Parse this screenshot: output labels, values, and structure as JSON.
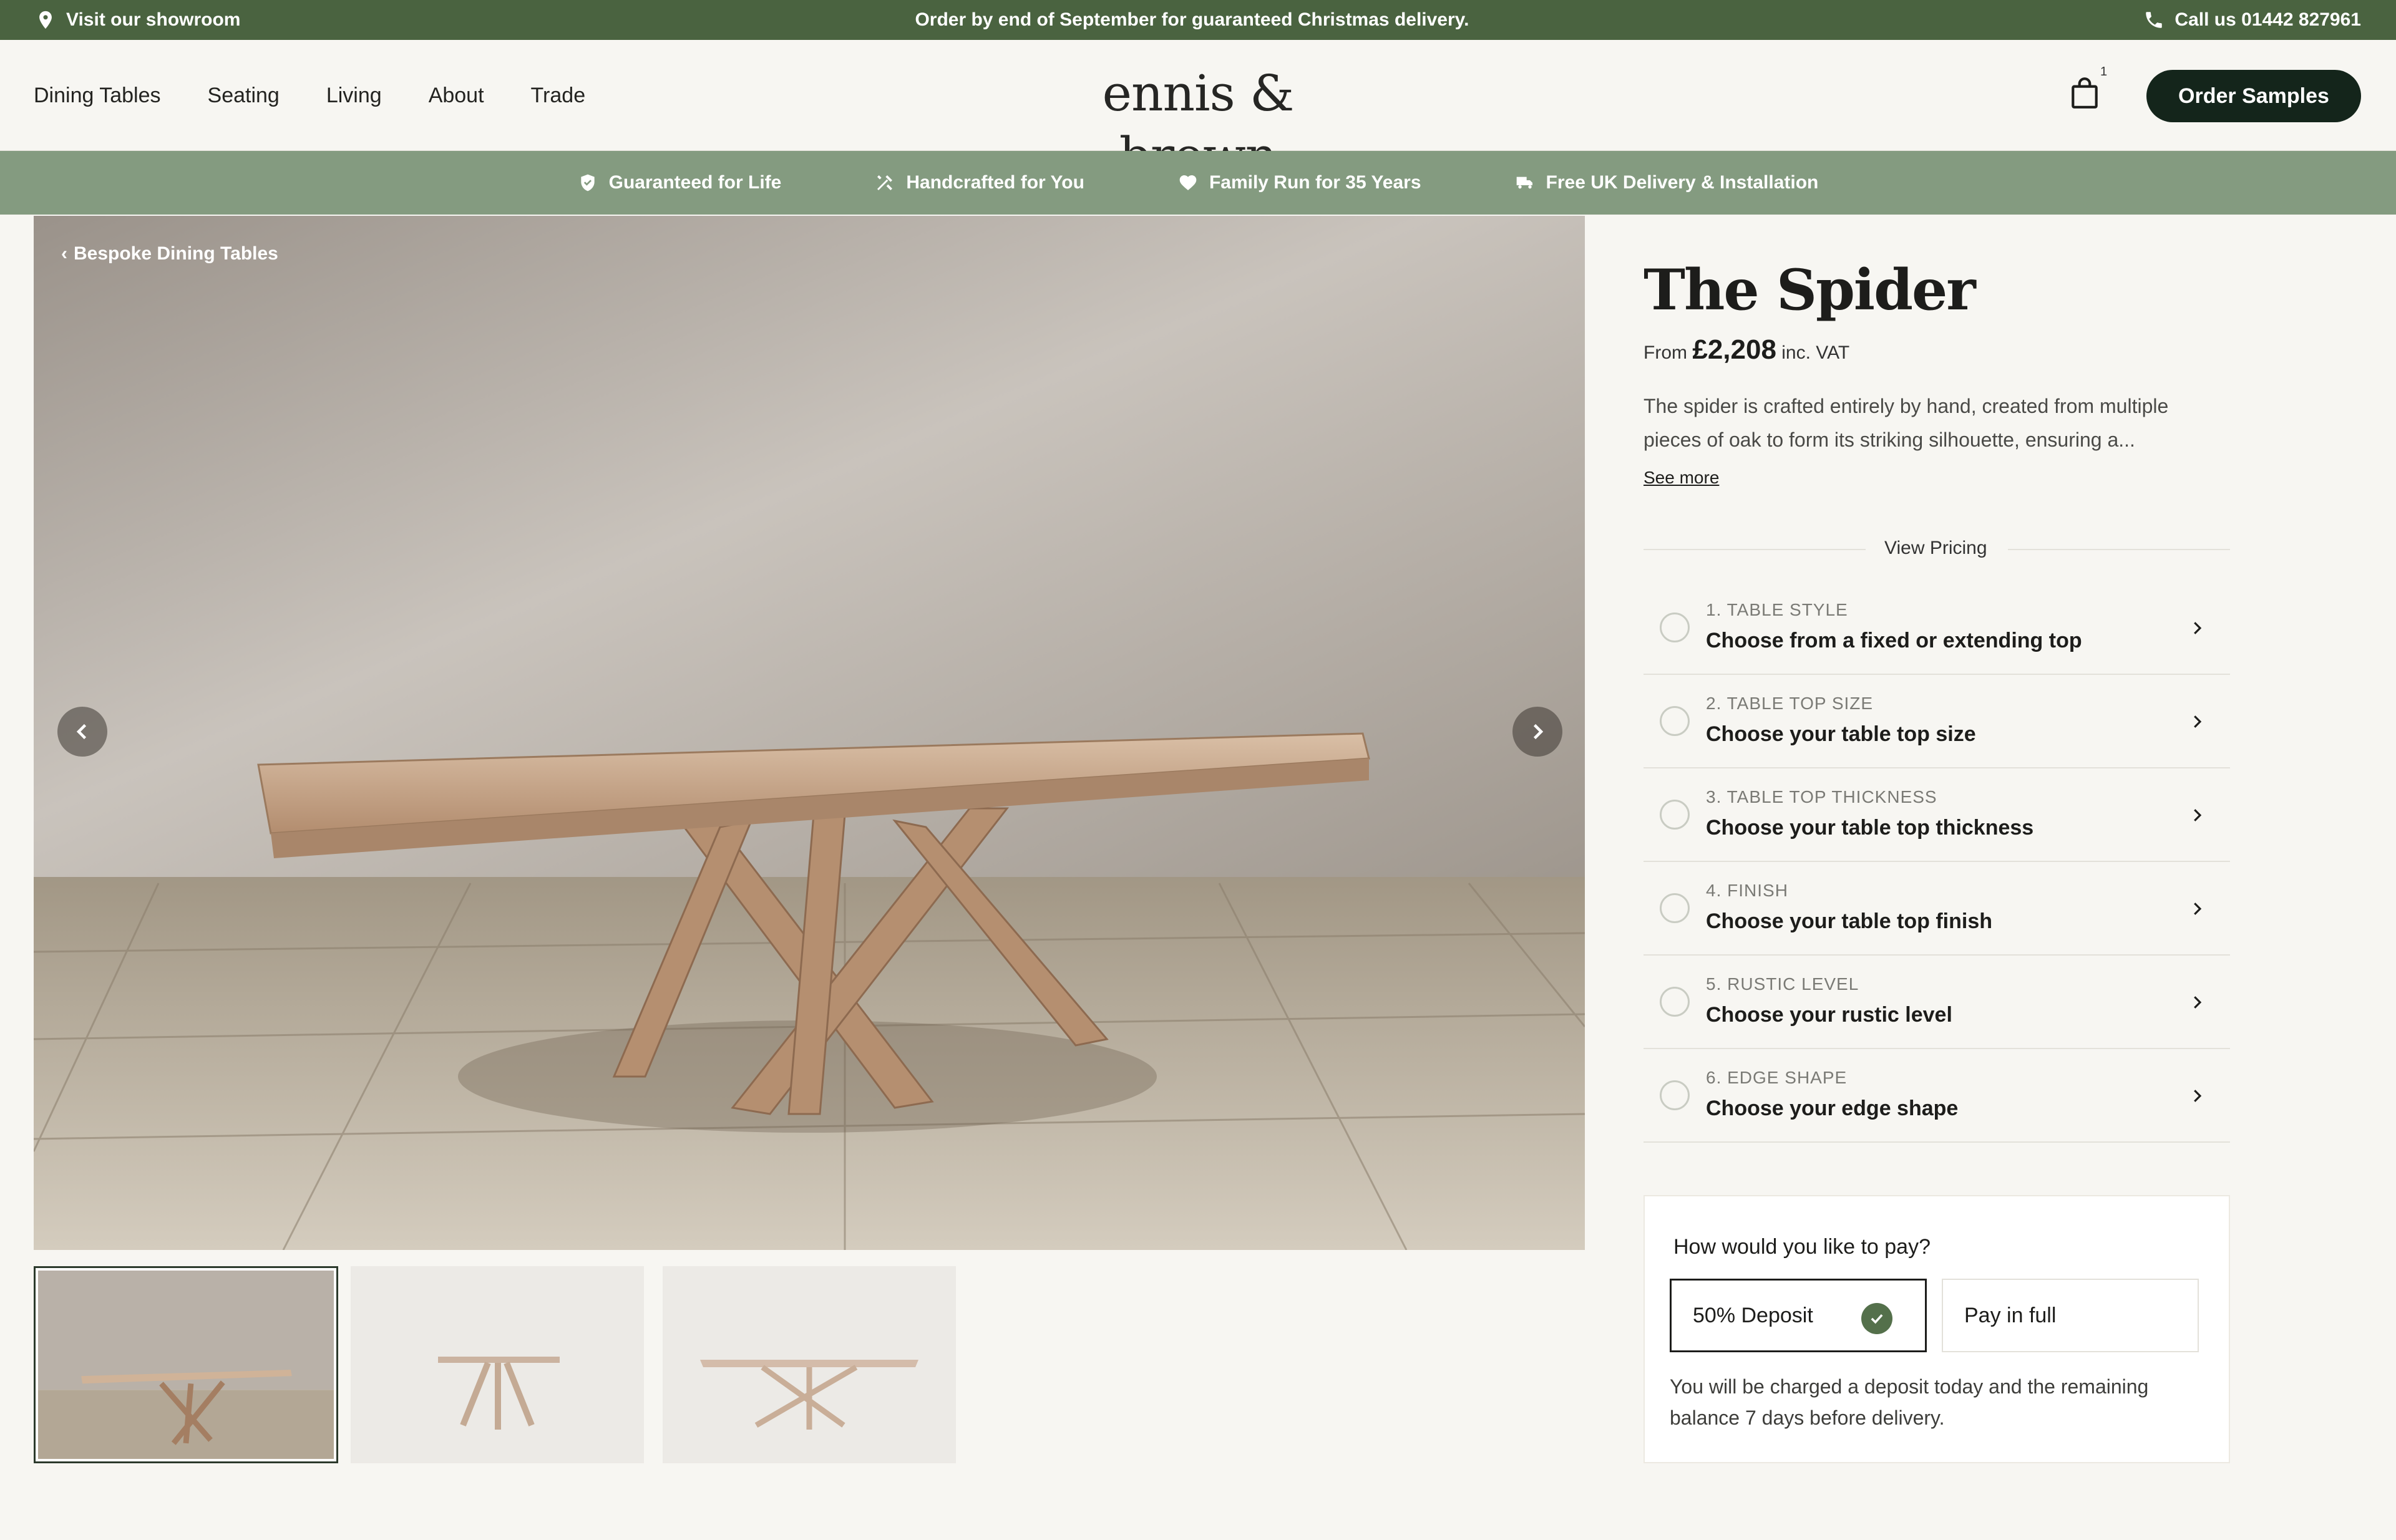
{
  "topbar": {
    "showroom": "Visit our showroom",
    "announcement": "Order by end of September for guaranteed Christmas delivery.",
    "phone": "Call us 01442 827961"
  },
  "nav": [
    "Dining Tables",
    "Seating",
    "Living",
    "About",
    "Trade"
  ],
  "brand": {
    "logo": "ennis & brown"
  },
  "header": {
    "cart_count": "1",
    "order_samples": "Order Samples"
  },
  "usp": [
    {
      "label": "Guaranteed for Life",
      "icon": "shield-check-icon"
    },
    {
      "label": "Handcrafted for You",
      "icon": "tools-icon"
    },
    {
      "label": "Family Run for 35 Years",
      "icon": "heart-icon"
    },
    {
      "label": "Free UK Delivery & Installation",
      "icon": "truck-icon"
    }
  ],
  "gallery": {
    "breadcrumb": "Bespoke Dining Tables",
    "thumbnails": 3,
    "active_thumbnail": 1
  },
  "product": {
    "title": "The Spider",
    "price_prefix": "From",
    "price": "£2,208",
    "price_suffix": "inc. VAT",
    "description": "The spider is crafted entirely by hand, created from multiple pieces of oak to form its striking silhouette, ensuring a...",
    "see_more": "See more",
    "view_pricing": "View Pricing"
  },
  "steps": [
    {
      "num": "1. TABLE STYLE",
      "text": "Choose from a fixed or extending top"
    },
    {
      "num": "2. TABLE TOP SIZE",
      "text": "Choose your table top size"
    },
    {
      "num": "3. TABLE TOP THICKNESS",
      "text": "Choose your table top thickness"
    },
    {
      "num": "4. FINISH",
      "text": "Choose your table top finish"
    },
    {
      "num": "5. RUSTIC LEVEL",
      "text": "Choose your rustic level"
    },
    {
      "num": "6. EDGE SHAPE",
      "text": "Choose your edge shape"
    }
  ],
  "payment": {
    "question": "How would you like to pay?",
    "option_deposit": "50% Deposit",
    "option_full": "Pay in full",
    "selected": "50% Deposit",
    "note": "You will be charged a deposit today and the remaining balance 7 days before delivery."
  },
  "colors": {
    "topbar": "#4a6340",
    "usp_bar": "#849b80",
    "button": "#14251b",
    "check": "#54704b"
  }
}
